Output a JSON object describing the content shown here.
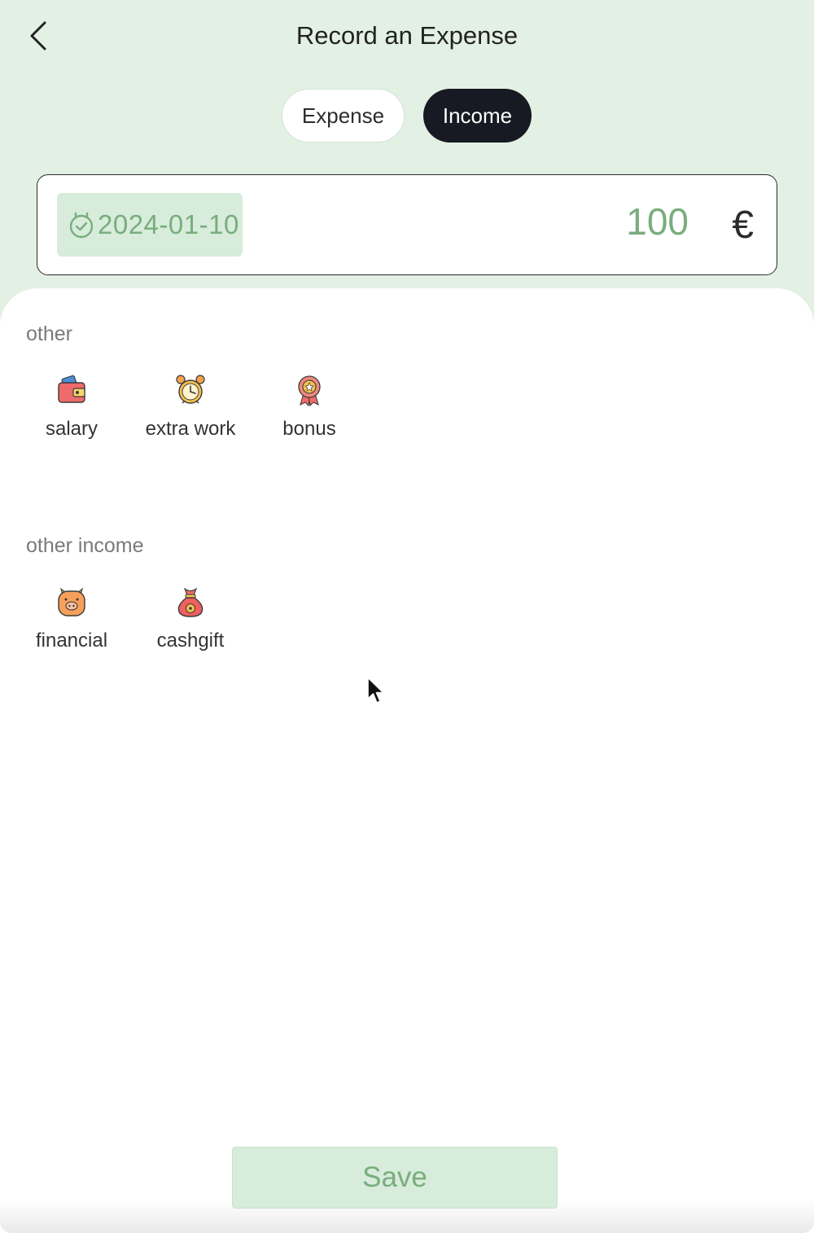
{
  "header": {
    "title": "Record an Expense",
    "back_icon": "chevron-left-icon"
  },
  "type_toggle": {
    "expense_label": "Expense",
    "income_label": "Income",
    "selected": "Income"
  },
  "entry": {
    "date": "2024-01-10",
    "date_icon": "calendar-check-icon",
    "amount": "100",
    "currency": "€"
  },
  "sections": [
    {
      "title": "other",
      "items": [
        {
          "label": "salary",
          "icon": "wallet-icon"
        },
        {
          "label": "extra work",
          "icon": "alarm-clock-icon"
        },
        {
          "label": "bonus",
          "icon": "medal-icon"
        }
      ]
    },
    {
      "title": "other income",
      "items": [
        {
          "label": "financial",
          "icon": "piggy-bank-icon"
        },
        {
          "label": "cashgift",
          "icon": "money-bag-icon"
        }
      ]
    }
  ],
  "footer": {
    "save_label": "Save"
  },
  "colors": {
    "background": "#e3f1e5",
    "accent_green": "#79ad7d",
    "chip_green": "#d7ecda",
    "dark_pill": "#171a22"
  }
}
